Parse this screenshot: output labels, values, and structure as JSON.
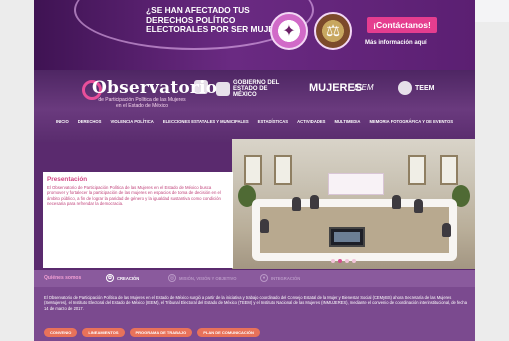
{
  "banner": {
    "question": "¿SE HAN AFECTADO TUS DERECHOS POLÍTICO ELECTORALES POR SER MUJER?",
    "cta_label": "¡Contáctanos!",
    "more_info": "Más información aquí",
    "badge_icons": [
      "ribbon-icon",
      "scales-icon"
    ]
  },
  "header": {
    "title": "Observatorio",
    "subtitle": "de Participación Política de las Mujeres en el Estado de México",
    "logos": {
      "gob": "GOBIERNO DEL ESTADO DE MÉXICO",
      "mujeres": "MUJERES",
      "ieem": "IEEM",
      "teem": "TEEM"
    }
  },
  "nav": [
    "INICIO",
    "DERECHOS",
    "VIOLENCIA POLÍTICA",
    "ELECCIONES ESTATALES Y MUNICIPALES",
    "ESTADÍSTICAS",
    "ACTIVIDADES",
    "MULTIMEDIA",
    "MEMORIA FOTOGRÁFICA Y DE EVENTOS"
  ],
  "hero": {
    "title": "Presentación",
    "text": "El Observatorio de Participación Política de las Mujeres en el Estado de México busca promover y fortalecer la participación de las mujeres en espacios de toma de decisión en el ámbito público, a fin de lograr la paridad de género y la igualdad sustantiva como condición necesaria para refrendar la democracia.",
    "slides": 4,
    "active_slide": 1
  },
  "about": {
    "label": "Quiénes somos",
    "tabs": [
      {
        "label": "CREACIÓN",
        "active": true
      },
      {
        "label": "MISIÓN, VISIÓN Y OBJETIVO",
        "active": false
      },
      {
        "label": "INTEGRACIÓN",
        "active": false
      }
    ],
    "text": "El Observatorio de Participación Política de las Mujeres en el Estado de México surgió a partir de la iniciativa y trabajo coordinado del Consejo Estatal de la Mujer y Bienestar Social (CEMyBS) ahora Secretaría de las Mujeres (SeMujeres), el Instituto Electoral del Estado de México (IEEM), el Tribunal Electoral del Estado de México (TEEM) y el Instituto Nacional de las Mujeres (INMUJERES), mediante el convenio de coordinación interinstitucional, de fecha 14 de marzo de 2017.",
    "buttons": [
      "CONVENIO",
      "LINEAMIENTOS",
      "PROGRAMA DE TRABAJO",
      "PLAN DE COMUNICACIÓN"
    ]
  },
  "colors": {
    "primary_purple": "#5a2a6e",
    "accent_pink": "#e53d8f",
    "button_coral": "#e8725a"
  }
}
